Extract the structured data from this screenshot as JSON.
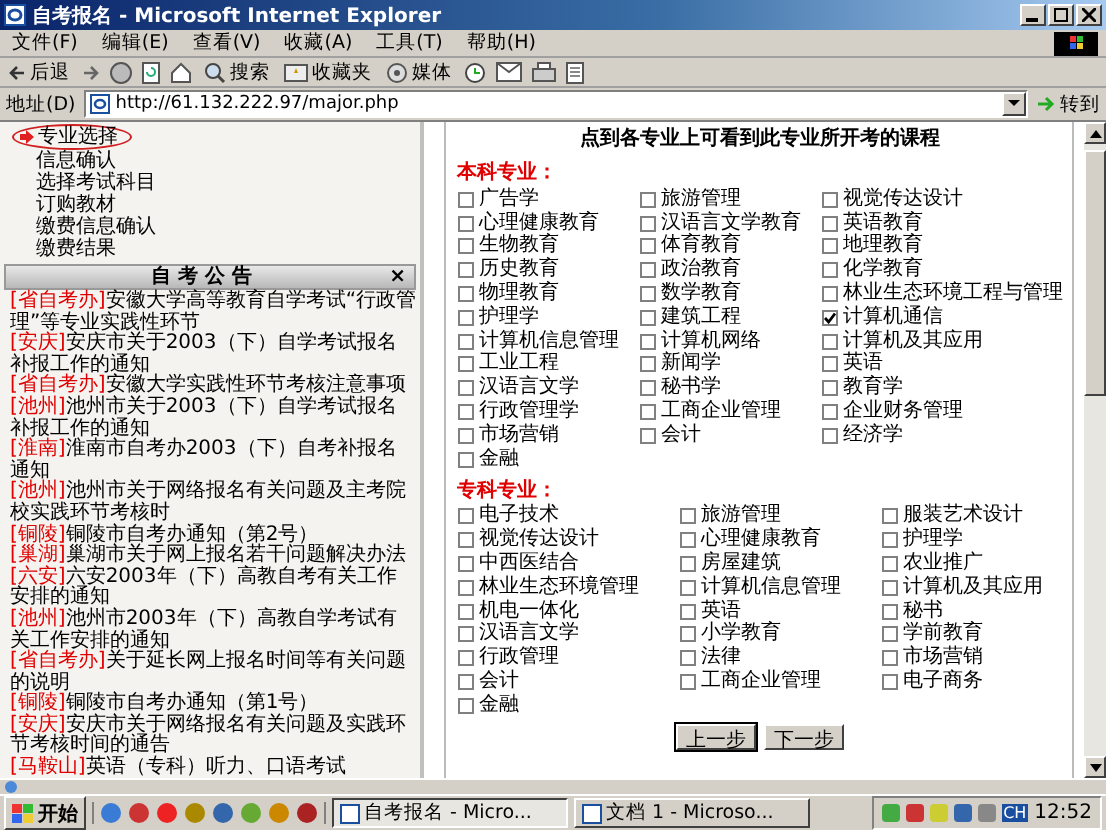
{
  "window": {
    "title": "自考报名 - Microsoft Internet Explorer"
  },
  "menu_bar": [
    "文件(F)",
    "编辑(E)",
    "查看(V)",
    "收藏(A)",
    "工具(T)",
    "帮助(H)"
  ],
  "toolbar": [
    {
      "kind": "back",
      "label": "后退"
    },
    {
      "kind": "forward"
    },
    {
      "kind": "stop"
    },
    {
      "kind": "refresh"
    },
    {
      "kind": "home"
    },
    {
      "kind": "search",
      "label": "搜索"
    },
    {
      "kind": "favorites",
      "label": "收藏夹"
    },
    {
      "kind": "media",
      "label": "媒体"
    },
    {
      "kind": "history"
    },
    {
      "kind": "mail"
    },
    {
      "kind": "print"
    },
    {
      "kind": "edit"
    }
  ],
  "address_bar": {
    "label": "地址(D)",
    "value": "http://61.132.222.97/major.php",
    "go": "转到"
  },
  "sidebar": {
    "items": [
      {
        "label": "专业选择",
        "selected": true
      },
      {
        "label": "信息确认",
        "selected": false
      },
      {
        "label": "选择考试科目",
        "selected": false
      },
      {
        "label": "订购教材",
        "selected": false
      },
      {
        "label": "缴费信息确认",
        "selected": false
      },
      {
        "label": "缴费结果",
        "selected": false
      }
    ]
  },
  "notices": {
    "title": "自 考 公 告",
    "close": "×",
    "items": [
      {
        "source": "[省自考办]",
        "text": "安徽大学高等教育自学考试“行政管理”等专业实践性环节"
      },
      {
        "source": "[安庆]",
        "text": "安庆市关于2003（下）自学考试报名补报工作的通知"
      },
      {
        "source": "[省自考办]",
        "text": "安徽大学实践性环节考核注意事项"
      },
      {
        "source": "[池州]",
        "text": "池州市关于2003（下）自学考试报名补报工作的通知"
      },
      {
        "source": "[淮南]",
        "text": "淮南市自考办2003（下）自考补报名通知"
      },
      {
        "source": "[池州]",
        "text": "池州市关于网络报名有关问题及主考院校实践环节考核时"
      },
      {
        "source": "[铜陵]",
        "text": "铜陵市自考办通知（第2号）"
      },
      {
        "source": "[巢湖]",
        "text": "巢湖市关于网上报名若干问题解决办法"
      },
      {
        "source": "[六安]",
        "text": "六安2003年（下）高教自考有关工作安排的通知"
      },
      {
        "source": "[池州]",
        "text": "池州市2003年（下）高教自学考试有关工作安排的通知"
      },
      {
        "source": "[省自考办]",
        "text": "关于延长网上报名时间等有关问题的说明"
      },
      {
        "source": "[铜陵]",
        "text": "铜陵市自考办通知（第1号）"
      },
      {
        "source": "[安庆]",
        "text": "安庆市关于网络报名有关问题及实践环节考核时间的通告"
      },
      {
        "source": "[马鞍山]",
        "text": "英语（专科）听力、口语考试"
      }
    ]
  },
  "main": {
    "heading": "点到各专业上可看到此专业所开考的课程",
    "sections": [
      {
        "title": "本科专业：",
        "majors": [
          {
            "name": "广告学",
            "checked": false
          },
          {
            "name": "旅游管理",
            "checked": false
          },
          {
            "name": "视觉传达设计",
            "checked": false
          },
          {
            "name": "心理健康教育",
            "checked": false
          },
          {
            "name": "汉语言文学教育",
            "checked": false
          },
          {
            "name": "英语教育",
            "checked": false
          },
          {
            "name": "生物教育",
            "checked": false
          },
          {
            "name": "体育教育",
            "checked": false
          },
          {
            "name": "地理教育",
            "checked": false
          },
          {
            "name": "历史教育",
            "checked": false
          },
          {
            "name": "政治教育",
            "checked": false
          },
          {
            "name": "化学教育",
            "checked": false
          },
          {
            "name": "物理教育",
            "checked": false
          },
          {
            "name": "数学教育",
            "checked": false
          },
          {
            "name": "林业生态环境工程与管理",
            "checked": false
          },
          {
            "name": "护理学",
            "checked": false
          },
          {
            "name": "建筑工程",
            "checked": false
          },
          {
            "name": "计算机通信",
            "checked": true
          },
          {
            "name": "计算机信息管理",
            "checked": false
          },
          {
            "name": "计算机网络",
            "checked": false
          },
          {
            "name": "计算机及其应用",
            "checked": false
          },
          {
            "name": "工业工程",
            "checked": false
          },
          {
            "name": "新闻学",
            "checked": false
          },
          {
            "name": "英语",
            "checked": false
          },
          {
            "name": "汉语言文学",
            "checked": false
          },
          {
            "name": "秘书学",
            "checked": false
          },
          {
            "name": "教育学",
            "checked": false
          },
          {
            "name": "行政管理学",
            "checked": false
          },
          {
            "name": "工商企业管理",
            "checked": false
          },
          {
            "name": "企业财务管理",
            "checked": false
          },
          {
            "name": "市场营销",
            "checked": false
          },
          {
            "name": "会计",
            "checked": false
          },
          {
            "name": "经济学",
            "checked": false
          },
          {
            "name": "金融",
            "checked": false
          }
        ]
      },
      {
        "title": "专科专业：",
        "majors": [
          {
            "name": "电子技术",
            "checked": false
          },
          {
            "name": "旅游管理",
            "checked": false
          },
          {
            "name": "服装艺术设计",
            "checked": false
          },
          {
            "name": "视觉传达设计",
            "checked": false
          },
          {
            "name": "心理健康教育",
            "checked": false
          },
          {
            "name": "护理学",
            "checked": false
          },
          {
            "name": "中西医结合",
            "checked": false
          },
          {
            "name": "房屋建筑",
            "checked": false
          },
          {
            "name": "农业推广",
            "checked": false
          },
          {
            "name": "林业生态环境管理",
            "checked": false
          },
          {
            "name": "计算机信息管理",
            "checked": false
          },
          {
            "name": "计算机及其应用",
            "checked": false
          },
          {
            "name": "机电一体化",
            "checked": false
          },
          {
            "name": "英语",
            "checked": false
          },
          {
            "name": "秘书",
            "checked": false
          },
          {
            "name": "汉语言文学",
            "checked": false
          },
          {
            "name": "小学教育",
            "checked": false
          },
          {
            "name": "学前教育",
            "checked": false
          },
          {
            "name": "行政管理",
            "checked": false
          },
          {
            "name": "法律",
            "checked": false
          },
          {
            "name": "市场营销",
            "checked": false
          },
          {
            "name": "会计",
            "checked": false
          },
          {
            "name": "工商企业管理",
            "checked": false
          },
          {
            "name": "电子商务",
            "checked": false
          },
          {
            "name": "金融",
            "checked": false
          }
        ]
      }
    ],
    "buttons": [
      "上一步",
      "下一步"
    ]
  },
  "taskbar": {
    "start": "开始",
    "tasks": [
      {
        "label": "自考报名 - Micro...",
        "selected": true
      },
      {
        "label": "文档 1 - Microso...",
        "selected": false
      }
    ],
    "language": "CH",
    "clock": "12:52"
  }
}
